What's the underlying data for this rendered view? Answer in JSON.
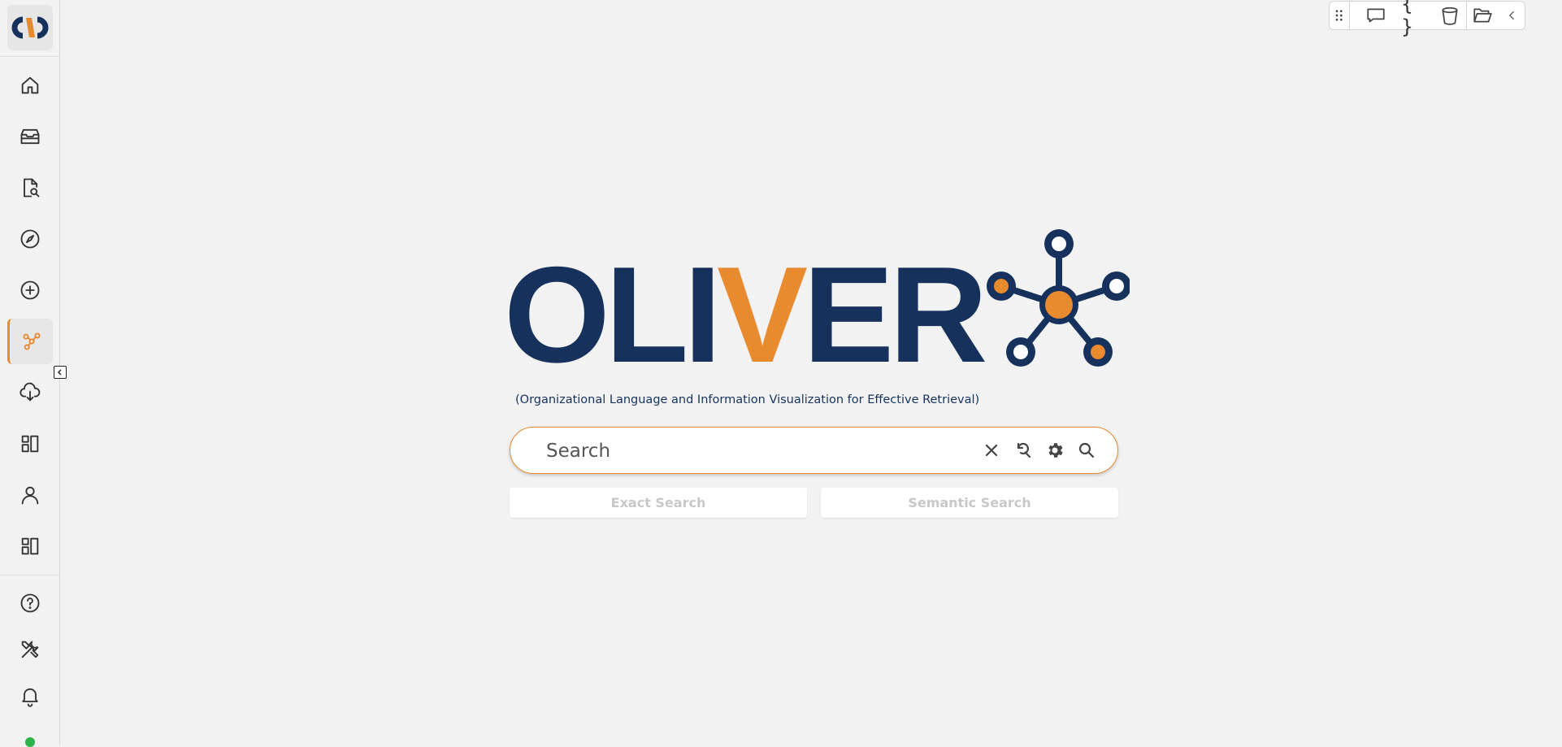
{
  "sidebar": {
    "items": [
      {
        "name": "home",
        "icon": "home-icon"
      },
      {
        "name": "inbox",
        "icon": "inbox-stack-icon"
      },
      {
        "name": "document-search",
        "icon": "document-search-icon"
      },
      {
        "name": "explore",
        "icon": "compass-icon"
      },
      {
        "name": "add",
        "icon": "plus-circle-icon"
      },
      {
        "name": "graph",
        "icon": "graph-nodes-icon",
        "active": true
      },
      {
        "name": "cloud-download",
        "icon": "cloud-download-icon"
      },
      {
        "name": "dashboard",
        "icon": "dashboard-icon"
      },
      {
        "name": "profile",
        "icon": "user-icon"
      },
      {
        "name": "dashboard-2",
        "icon": "dashboard-icon"
      }
    ],
    "bottom_items": [
      {
        "name": "help",
        "icon": "help-circle-icon"
      },
      {
        "name": "tools",
        "icon": "tools-icon"
      },
      {
        "name": "notifications",
        "icon": "bell-icon"
      }
    ],
    "status_color": "#2db34a"
  },
  "toolbar": {
    "braces_label": "{ }",
    "icons": [
      "drag-grip-icon",
      "chat-icon",
      "braces-icon",
      "bucket-icon",
      "folder-open-icon",
      "chevron-left-icon"
    ]
  },
  "brand": {
    "letters_a": "OLI",
    "letter_v": "V",
    "letters_b": "ER",
    "subtitle": "(Organizational Language and Information Visualization for Effective Retrieval)",
    "primary_color": "#16325c",
    "accent_color": "#e88a2e"
  },
  "search": {
    "placeholder": "Search",
    "value": ""
  },
  "modes": {
    "exact": "Exact Search",
    "semantic": "Semantic Search"
  }
}
